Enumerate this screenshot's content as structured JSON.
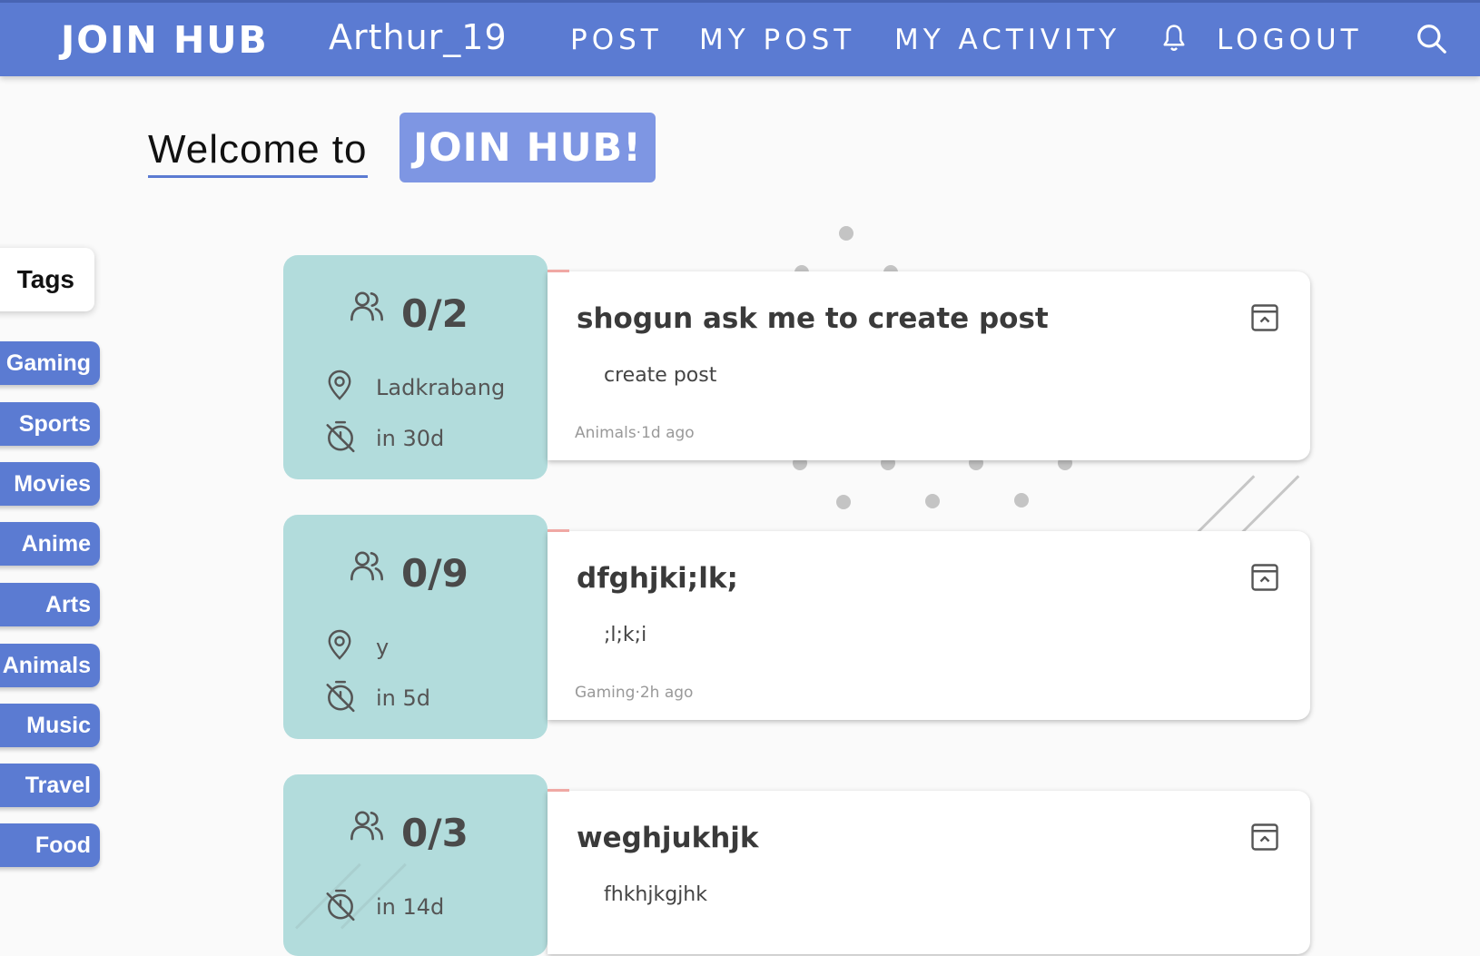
{
  "navbar": {
    "brand": "JOIN HUB",
    "username": "Arthur_19",
    "links": [
      "POST",
      "MY POST",
      "MY ACTIVITY"
    ],
    "notification_icon": "bell-icon",
    "logout": "LOGOUT",
    "search_icon": "search-icon",
    "color": "#5b7bd2"
  },
  "welcome": {
    "prefix": "Welcome to",
    "brand": "JOIN HUB!"
  },
  "tags": {
    "header": "Tags",
    "items": [
      "Gaming",
      "Sports",
      "Movies",
      "Anime",
      "Arts",
      "Animals",
      "Music",
      "Travel",
      "Food"
    ]
  },
  "posts": [
    {
      "participants": "0/2",
      "location": "Ladkrabang",
      "due": "in 30d",
      "title": "shogun ask me to create post",
      "description": "create post",
      "meta": "Animals·1d ago"
    },
    {
      "participants": "0/9",
      "location": "y",
      "due": "in 5d",
      "title": "dfghjki;lk;",
      "description": ";l;k;i",
      "meta": "Gaming·2h ago"
    },
    {
      "participants": "0/3",
      "due": "in 14d",
      "title": "weghjukhjk",
      "description": "fhkhjkgjhk"
    }
  ],
  "colors": {
    "accent": "#5b7bd2",
    "card_side": "#b2dcdc",
    "welcome_brand_bg": "#7e96e3"
  }
}
